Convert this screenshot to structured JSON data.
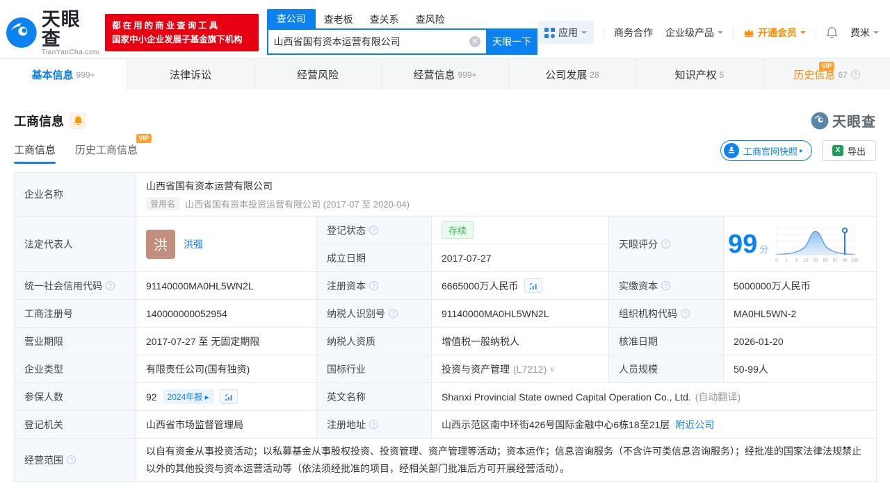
{
  "header": {
    "logo": {
      "brand": "天眼查",
      "domain": "TianYanCha.com"
    },
    "promo": {
      "line1": "都在用的商业查询工具",
      "line2": "国家中小企业发展子基金旗下机构"
    },
    "search": {
      "tabs": [
        {
          "label": "查公司"
        },
        {
          "label": "查老板"
        },
        {
          "label": "查关系"
        },
        {
          "label": "查风险"
        }
      ],
      "value": "山西省国有资本运营有限公司",
      "button": "天眼一下"
    },
    "nav": {
      "apps": "应用",
      "cooperation": "商务合作",
      "enterprise": "企业级产品",
      "vip": "开通会员",
      "user": "费米"
    }
  },
  "tabs": [
    {
      "label": "基本信息",
      "count": "999+"
    },
    {
      "label": "法律诉讼",
      "count": ""
    },
    {
      "label": "经营风险",
      "count": ""
    },
    {
      "label": "经营信息",
      "count": "999+"
    },
    {
      "label": "公司发展",
      "count": "28"
    },
    {
      "label": "知识产权",
      "count": "5"
    },
    {
      "label": "历史信息",
      "count": "67",
      "vip": "VIP"
    }
  ],
  "section": {
    "title": "工商信息",
    "watermark": "天眼查",
    "subtab_current": "工商信息",
    "subtab_history": "历史工商信息",
    "vip_badge": "VIP",
    "snapshot_button": "工商官网快照",
    "export_button": "导出"
  },
  "fields": {
    "company_name": {
      "label": "企业名称",
      "value": "山西省国有资本运营有限公司",
      "former_tag": "曾用名",
      "former": "山西省国有资本投资运营有限公司 (2017-07 至 2020-04)"
    },
    "legal_rep": {
      "label": "法定代表人",
      "avatar": "洪",
      "name": "洪强"
    },
    "reg_status": {
      "label": "登记状态",
      "value": "存续"
    },
    "establish_date": {
      "label": "成立日期",
      "value": "2017-07-27"
    },
    "score": {
      "label": "天眼评分",
      "value": "99",
      "unit": "分"
    },
    "credit_code": {
      "label": "统一社会信用代码",
      "value": "91140000MA0HL5WN2L"
    },
    "reg_capital": {
      "label": "注册资本",
      "value": "6665000万人民币"
    },
    "paid_capital": {
      "label": "实缴资本",
      "value": "5000000万人民币"
    },
    "reg_number": {
      "label": "工商注册号",
      "value": "140000000052954"
    },
    "taxpayer_id": {
      "label": "纳税人识别号",
      "value": "91140000MA0HL5WN2L"
    },
    "org_code": {
      "label": "组织机构代码",
      "value": "MA0HL5WN-2"
    },
    "business_term": {
      "label": "营业期限",
      "value": "2017-07-27 至 无固定期限"
    },
    "taxpayer_quality": {
      "label": "纳税人资质",
      "value": "增值税一般纳税人"
    },
    "approval_date": {
      "label": "核准日期",
      "value": "2026-01-20"
    },
    "company_type": {
      "label": "企业类型",
      "value": "有限责任公司(国有独资)"
    },
    "industry": {
      "label": "国标行业",
      "value": "投资与资产管理",
      "code": "(L7212)"
    },
    "staff_size": {
      "label": "人员规模",
      "value": "50-99人"
    },
    "insured": {
      "label": "参保人数",
      "value": "92",
      "report_tag": "2024年报"
    },
    "english_name": {
      "label": "英文名称",
      "value": "Shanxi Provincial State owned Capital Operation Co., Ltd.",
      "note": "(自动翻译)"
    },
    "reg_authority": {
      "label": "登记机关",
      "value": "山西省市场监督管理局"
    },
    "address": {
      "label": "注册地址",
      "value": "山西示范区南中环街426号国际金融中心6栋18至21层",
      "nearby_link": "附近公司"
    },
    "business_scope": {
      "label": "经营范围",
      "value": "以自有资金从事投资活动；以私募基金从事股权投资、投资管理、资产管理等活动；资本运作；信息咨询服务（不含许可类信息咨询服务）；经批准的国家法律法规禁止以外的其他投资与资本运营活动等（依法须经批准的项目，经相关部门批准后方可开展经营活动）。"
    }
  },
  "chart_data": {
    "type": "area",
    "title": "天眼评分",
    "x_ticks": [
      "0",
      "1",
      "3",
      "15",
      "50",
      "85",
      "97",
      "99",
      "100"
    ],
    "marker_value": 99,
    "score": 99
  }
}
